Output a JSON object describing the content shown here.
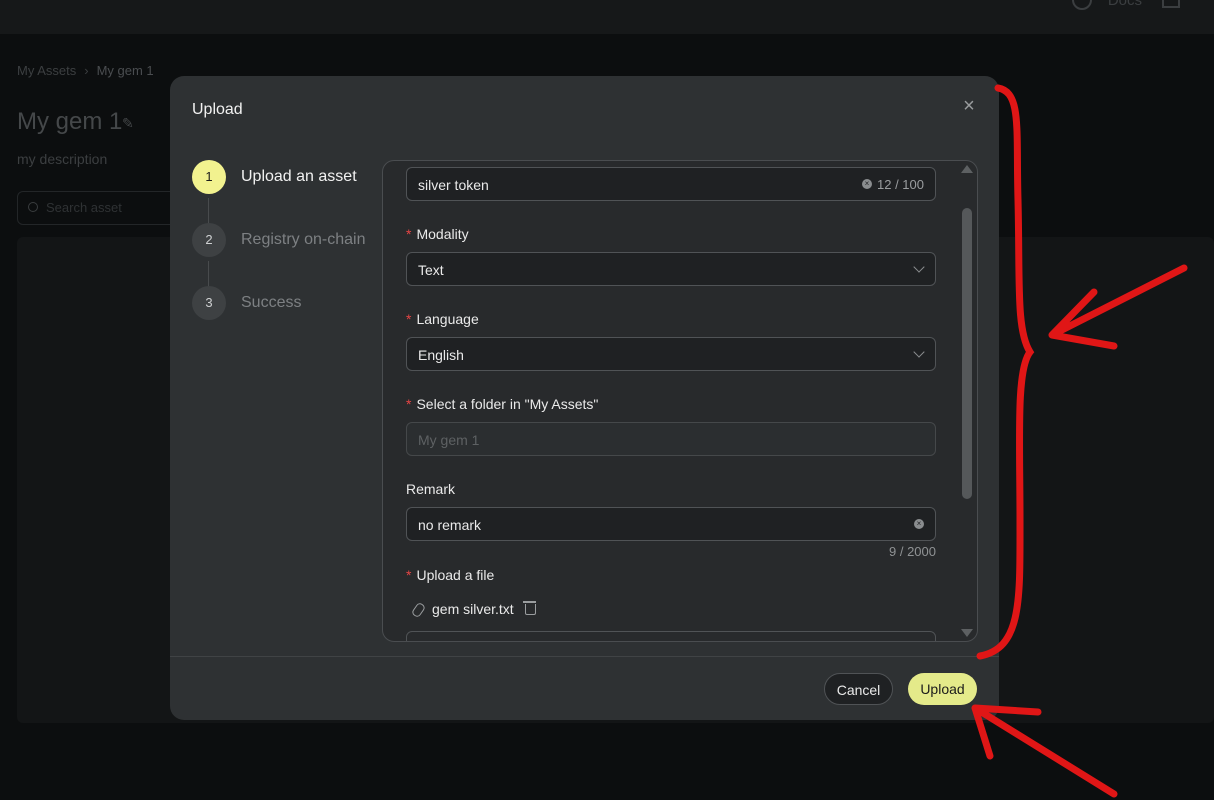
{
  "background": {
    "top_link": "Docs",
    "breadcrumb": [
      "My Assets",
      "My gem 1"
    ],
    "page_title": "My gem 1",
    "page_description": "my description",
    "search_placeholder": "Search asset"
  },
  "modal": {
    "title": "Upload",
    "steps": [
      {
        "num": "1",
        "label": "Upload an asset",
        "active": true
      },
      {
        "num": "2",
        "label": "Registry on-chain",
        "active": false
      },
      {
        "num": "3",
        "label": "Success",
        "active": false
      }
    ],
    "form": {
      "name_value": "silver token",
      "name_count": "12 / 100",
      "modality_label": "Modality",
      "modality_value": "Text",
      "language_label": "Language",
      "language_value": "English",
      "folder_label": "Select a folder in \"My Assets\"",
      "folder_value": "My gem 1",
      "remark_label": "Remark",
      "remark_value": "no remark",
      "remark_count": "9 / 2000",
      "file_label": "Upload a file",
      "file_name": "gem silver.txt"
    },
    "buttons": {
      "cancel": "Cancel",
      "upload": "Upload"
    }
  },
  "colors": {
    "accent": "#e4ea8a",
    "required": "#e64545",
    "annotation": "#e01616"
  }
}
